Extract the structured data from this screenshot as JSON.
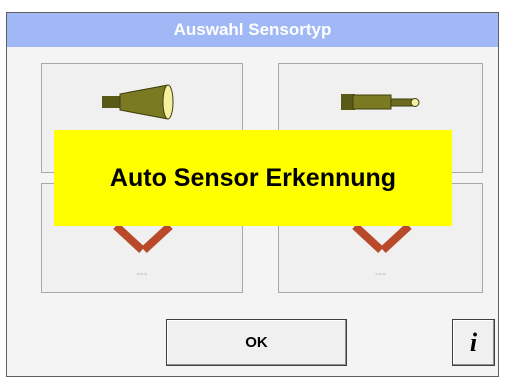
{
  "dialog": {
    "title": "Auswahl Sensortyp"
  },
  "tiles": [
    {
      "label": "",
      "icon": "large-probe-sensor-icon"
    },
    {
      "label": "",
      "icon": "thin-probe-sensor-icon"
    },
    {
      "label": "---",
      "icon": "no-sensor-cross-icon"
    },
    {
      "label": "---",
      "icon": "no-sensor-cross-icon"
    }
  ],
  "banner": {
    "text": "Auto Sensor Erkennung"
  },
  "buttons": {
    "ok_label": "OK",
    "info_label": "i"
  },
  "colors": {
    "titlebar": "#a0b8f5",
    "banner": "#ffff00",
    "sensor_body": "#6b6b1f",
    "cross": "#b84a2a"
  }
}
